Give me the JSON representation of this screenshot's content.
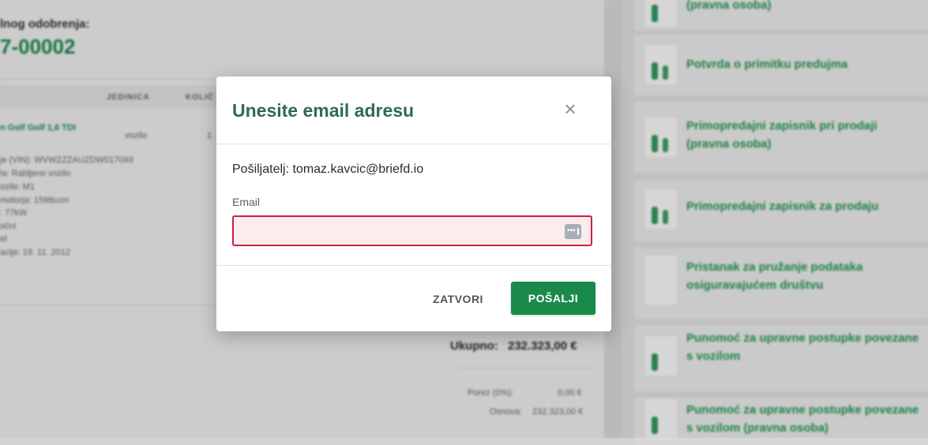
{
  "background": {
    "approval_label": "lnog odobrenja:",
    "approval_number": "7-00002",
    "column_headers": [
      "JEDINICA",
      "KOLIČ"
    ],
    "item": {
      "title": "n Golf Golf 1,6 TDI",
      "unit": "vozilo",
      "quantity": "1"
    },
    "item_details": [
      "je (VIN): WVWZZZAUZDW017093",
      "la: Rabljeno vozilo",
      "ozile: M1",
      "motorja: 1598ccm",
      ": 77kW",
      "očni",
      "el",
      "acije: 19. 11. 2012"
    ],
    "total_label": "Ukupno:",
    "total_value": "232.323,00 €",
    "tax_rows": [
      {
        "label": "Porez (0%):",
        "value": "0,00 €"
      },
      {
        "label": "Osnova:",
        "value": "232.323,00 €"
      }
    ],
    "documents": [
      "(pravna osoba)",
      "Potvrda o primitku predujma",
      "Primopredajni zapisnik pri prodaji (pravna osoba)",
      "Primopredajni zapisnik za prodaju",
      "Pristanak za pružanje podataka osiguravajućem društvu",
      "Punomoć za upravne postupke povezane s vozilom",
      "Punomoć za upravne postupke povezane s vozilom (pravna osoba)"
    ]
  },
  "modal": {
    "title": "Unesite email adresu",
    "close_icon": "×",
    "sender_text": "Pošiljatelj: tomaz.kavcic@briefd.io",
    "email_label": "Email",
    "email_value": "",
    "autofill_icon_name": "password-autofill-icon",
    "close_button_label": "ZATVORI",
    "send_button_label": "POŠALJI",
    "accent_color": "#1a8a4b",
    "error_color": "#c8243f"
  }
}
